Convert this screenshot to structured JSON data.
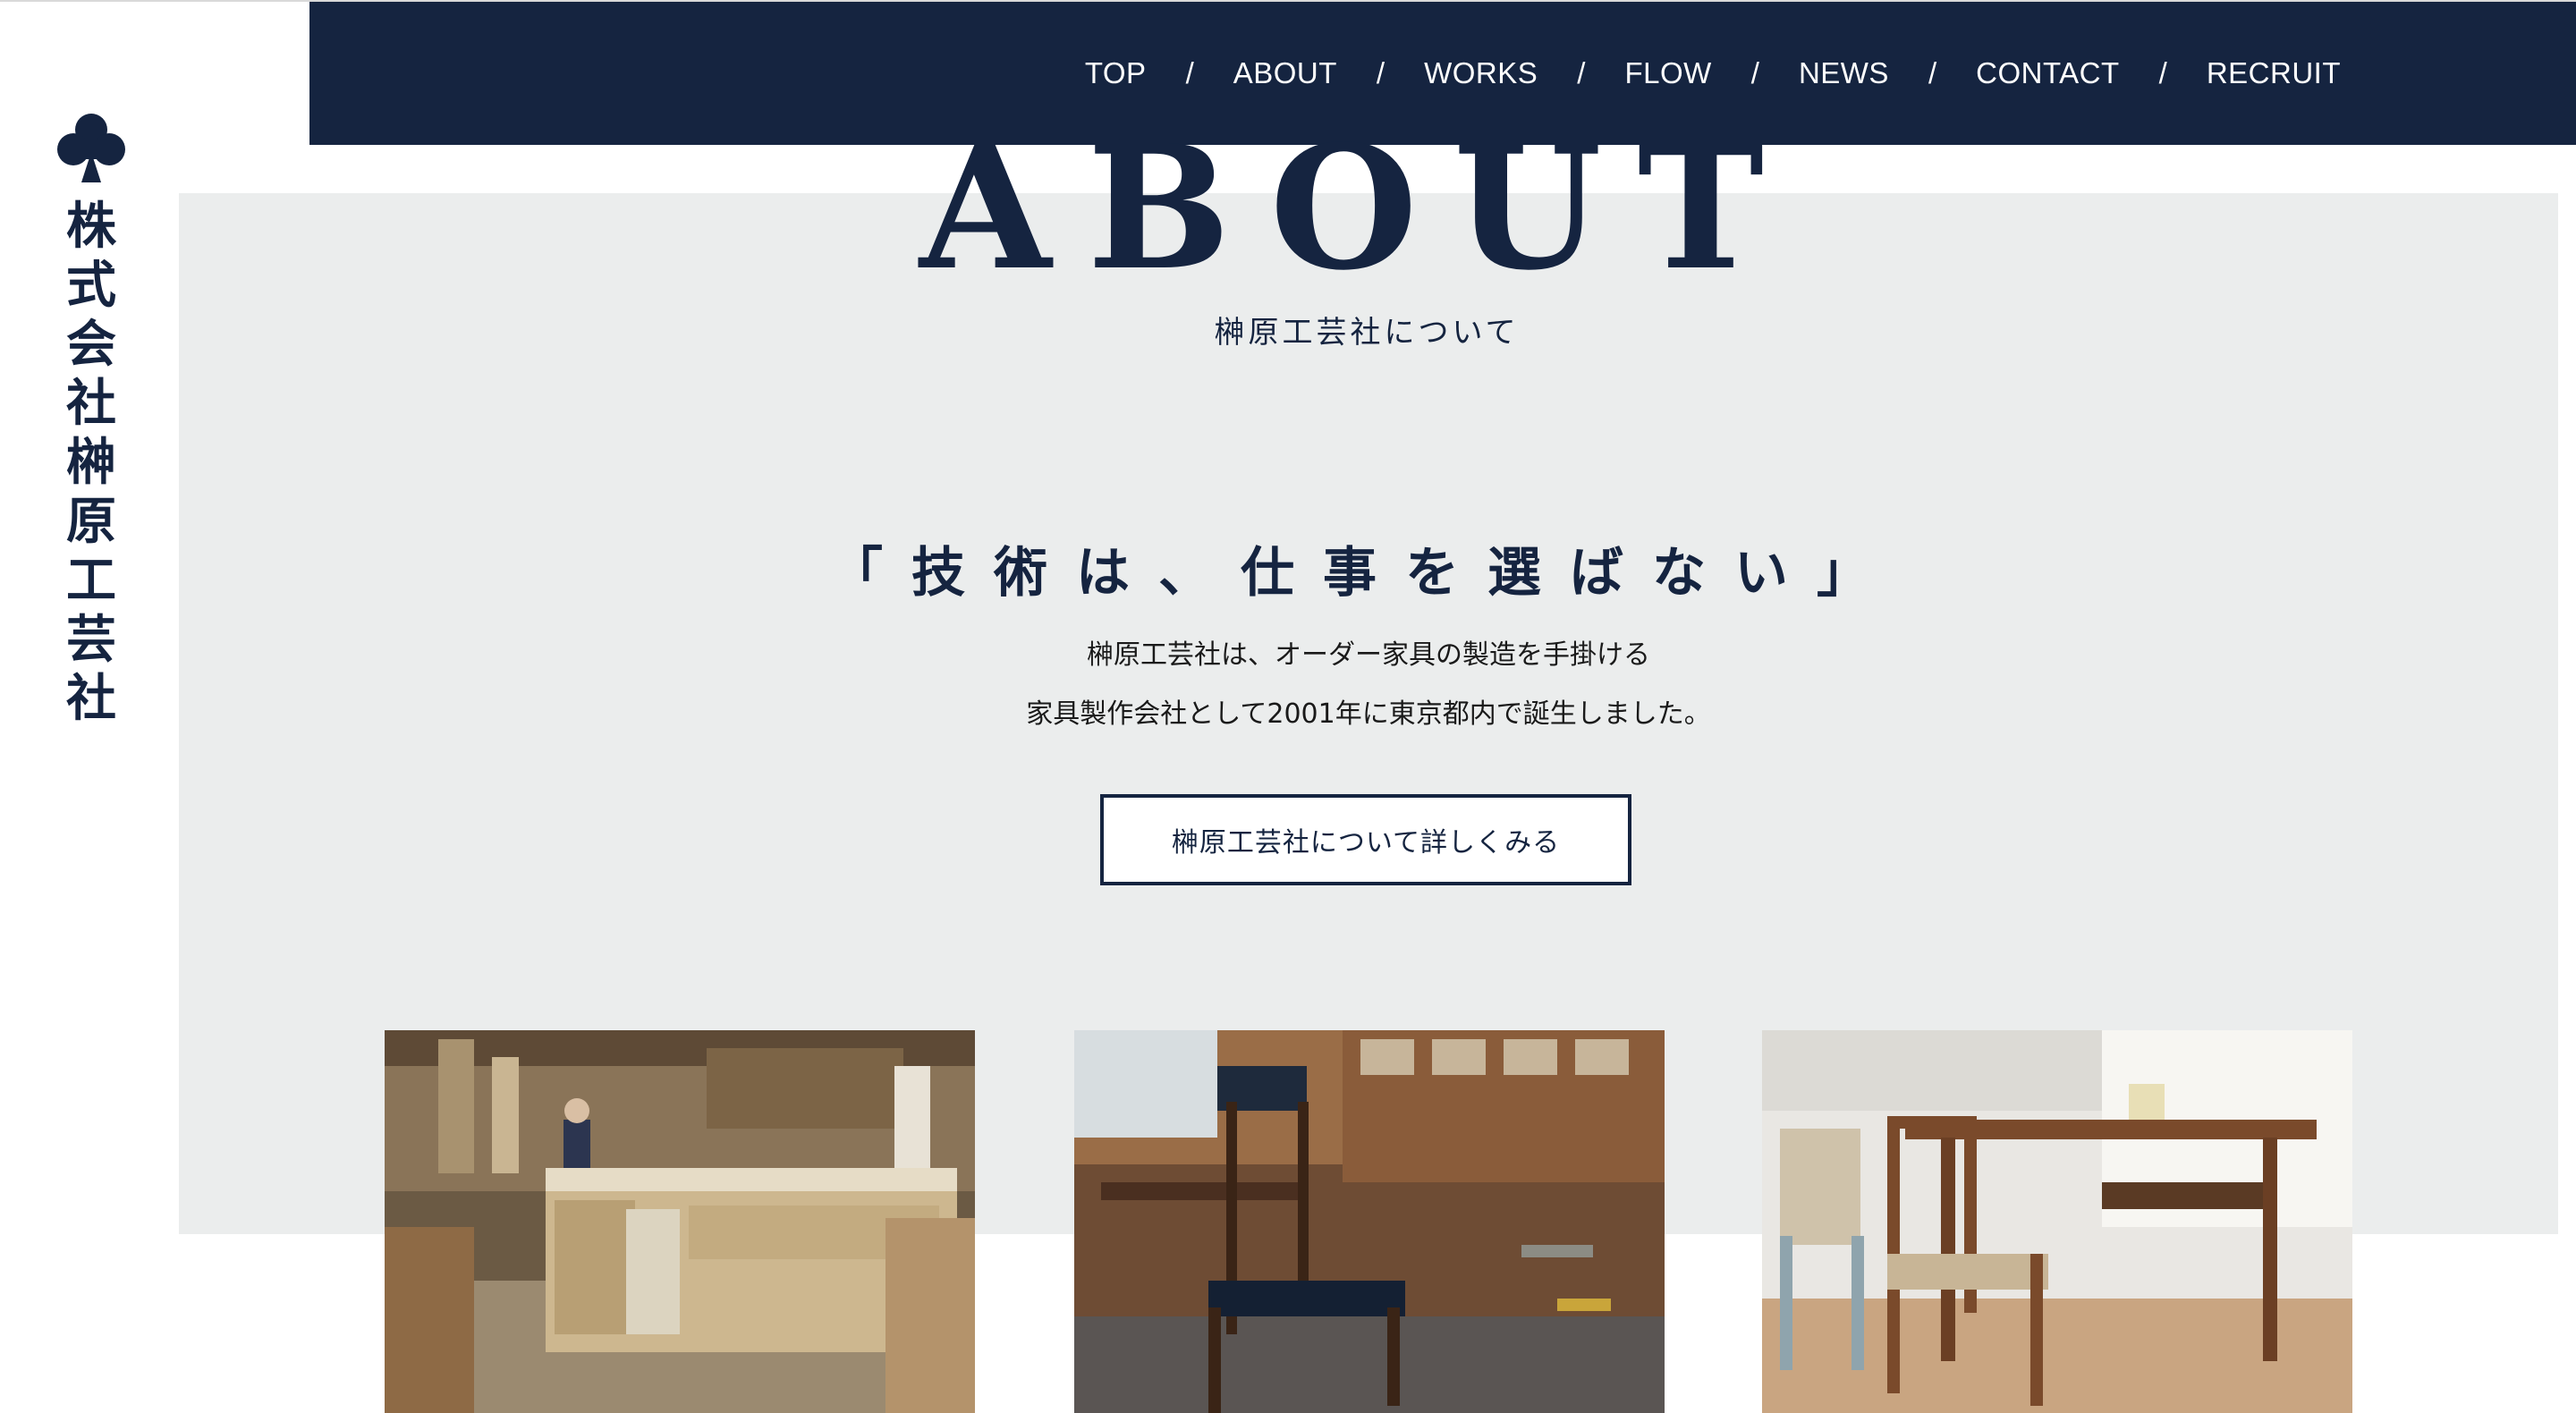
{
  "nav": {
    "items": [
      "TOP",
      "ABOUT",
      "WORKS",
      "FLOW",
      "NEWS",
      "CONTACT",
      "RECRUIT"
    ],
    "separator": "/"
  },
  "brand": {
    "icon": "club-icon",
    "name_chars": [
      "株",
      "式",
      "会",
      "社",
      "榊",
      "原",
      "工",
      "芸",
      "社"
    ]
  },
  "about": {
    "title": "ABOUT",
    "subtitle": "榊原工芸社について",
    "catchphrase": "「技術は、仕事を選ばない」",
    "lead_line1": "榊原工芸社は、オーダー家具の製造を手掛ける",
    "lead_line2": "家具製作会社として2001年に東京都内で誕生しました。",
    "button_label": "榊原工芸社について詳しくみる"
  },
  "colors": {
    "navy": "#152440",
    "panel_gray": "#ebeded",
    "white": "#ffffff"
  }
}
